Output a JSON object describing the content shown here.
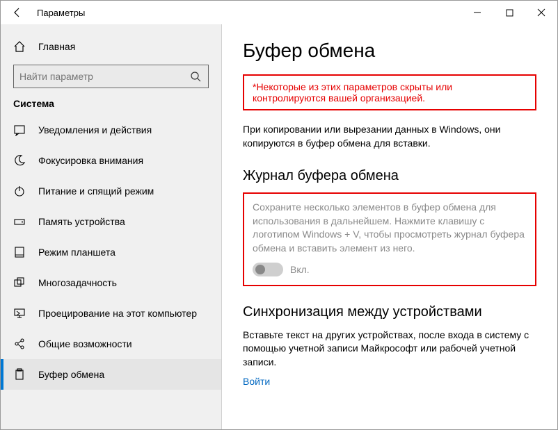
{
  "titlebar": {
    "title": "Параметры"
  },
  "sidebar": {
    "home": "Главная",
    "search_placeholder": "Найти параметр",
    "section": "Система",
    "items": [
      {
        "label": "Уведомления и действия"
      },
      {
        "label": "Фокусировка внимания"
      },
      {
        "label": "Питание и спящий режим"
      },
      {
        "label": "Память устройства"
      },
      {
        "label": "Режим планшета"
      },
      {
        "label": "Многозадачность"
      },
      {
        "label": "Проецирование на этот компьютер"
      },
      {
        "label": "Общие возможности"
      },
      {
        "label": "Буфер обмена"
      }
    ]
  },
  "main": {
    "title": "Буфер обмена",
    "alert": "*Некоторые из этих параметров скрыты или контролируются вашей организацией.",
    "desc": "При копировании или вырезании данных в Windows, они копируются в буфер обмена для вставки.",
    "history": {
      "heading": "Журнал буфера обмена",
      "desc": "Сохраните несколько элементов в буфер обмена для использования в дальнейшем. Нажмите клавишу с логотипом Windows + V, чтобы просмотреть журнал буфера обмена и вставить элемент из него.",
      "toggle_label": "Вкл."
    },
    "sync": {
      "heading": "Синхронизация между устройствами",
      "desc": "Вставьте текст на других устройствах, после входа в систему с помощью учетной записи Майкрософт или рабочей учетной записи.",
      "link": "Войти"
    }
  }
}
